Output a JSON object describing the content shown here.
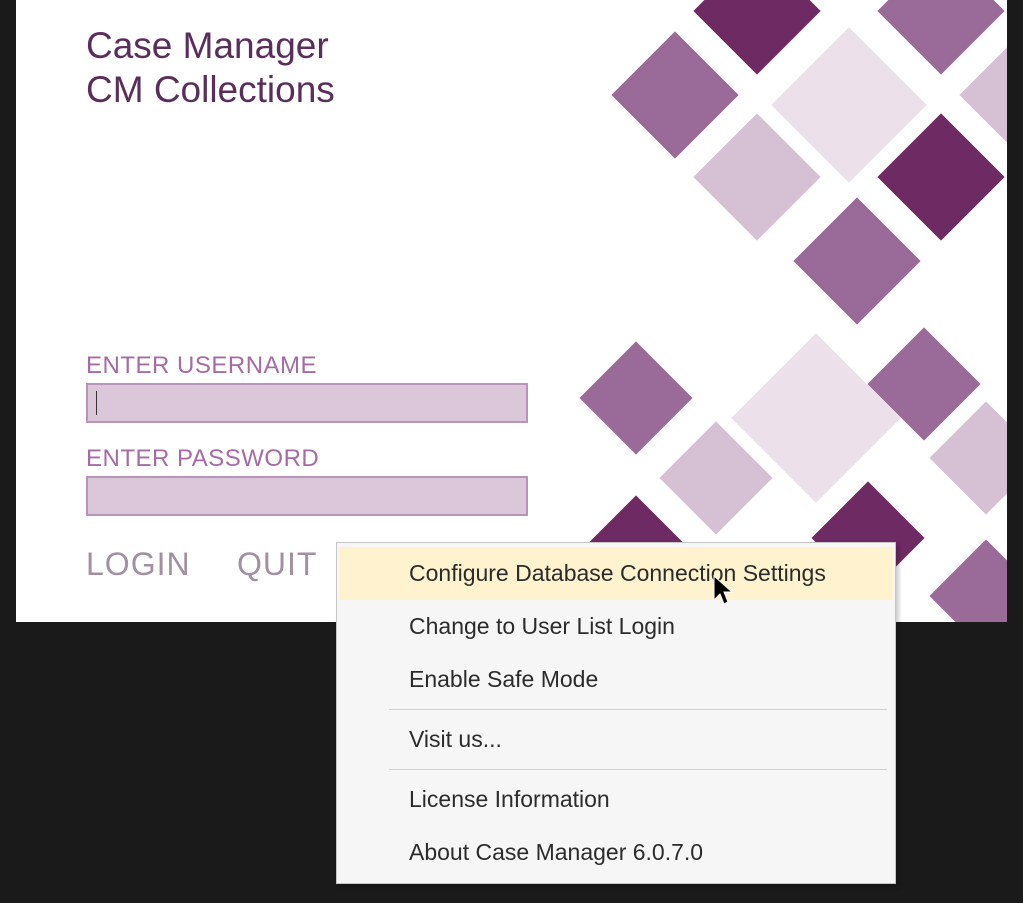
{
  "app": {
    "title": "Case Manager",
    "subtitle": "CM Collections"
  },
  "form": {
    "username_label": "ENTER USERNAME",
    "username_value": "",
    "password_label": "ENTER PASSWORD",
    "password_value": ""
  },
  "buttons": {
    "login": "LOGIN",
    "quit": "QUIT"
  },
  "menu": {
    "items": [
      {
        "label": "Configure Database Connection Settings",
        "highlighted": true
      },
      {
        "label": "Change to User List Login"
      },
      {
        "label": "Enable Safe Mode"
      },
      {
        "separator": true
      },
      {
        "label": "Visit us..."
      },
      {
        "separator": true
      },
      {
        "label": "License Information"
      },
      {
        "label": "About Case Manager 6.0.7.0"
      }
    ]
  },
  "colors": {
    "brand_dark": "#6e2a63",
    "brand_med": "#9a6a98",
    "brand_light": "#d6c1d4",
    "label": "#a56ca3",
    "menu_highlight": "#fff2ce"
  }
}
